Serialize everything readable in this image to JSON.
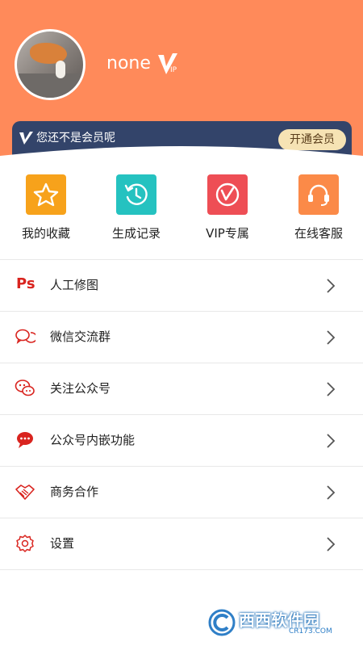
{
  "profile": {
    "username": "none",
    "vip_badge_text": "VIP"
  },
  "vip_banner": {
    "text": "您还不是会员呢",
    "button_label": "开通会员"
  },
  "quick_actions": [
    {
      "label": "我的收藏",
      "icon": "star-icon",
      "color": "#f7a21b"
    },
    {
      "label": "生成记录",
      "icon": "history-icon",
      "color": "#25c2c0"
    },
    {
      "label": "VIP专属",
      "icon": "vip-icon",
      "color": "#ee4e55"
    },
    {
      "label": "在线客服",
      "icon": "headset-icon",
      "color": "#fb8a48"
    }
  ],
  "menu": [
    {
      "label": "人工修图",
      "icon": "ps-icon"
    },
    {
      "label": "微信交流群",
      "icon": "chat-bubbles-icon"
    },
    {
      "label": "关注公众号",
      "icon": "wechat-icon"
    },
    {
      "label": "公众号内嵌功能",
      "icon": "message-icon"
    },
    {
      "label": "商务合作",
      "icon": "handshake-icon"
    },
    {
      "label": "设置",
      "icon": "gear-icon"
    }
  ],
  "watermark": {
    "brand": "西西软件园",
    "url": "CR173.COM"
  },
  "colors": {
    "header_bg": "#ff8a5a",
    "vip_bar_bg": "#33446a",
    "vip_button_bg": "#f6e3b4",
    "menu_icon": "#d9241f"
  }
}
